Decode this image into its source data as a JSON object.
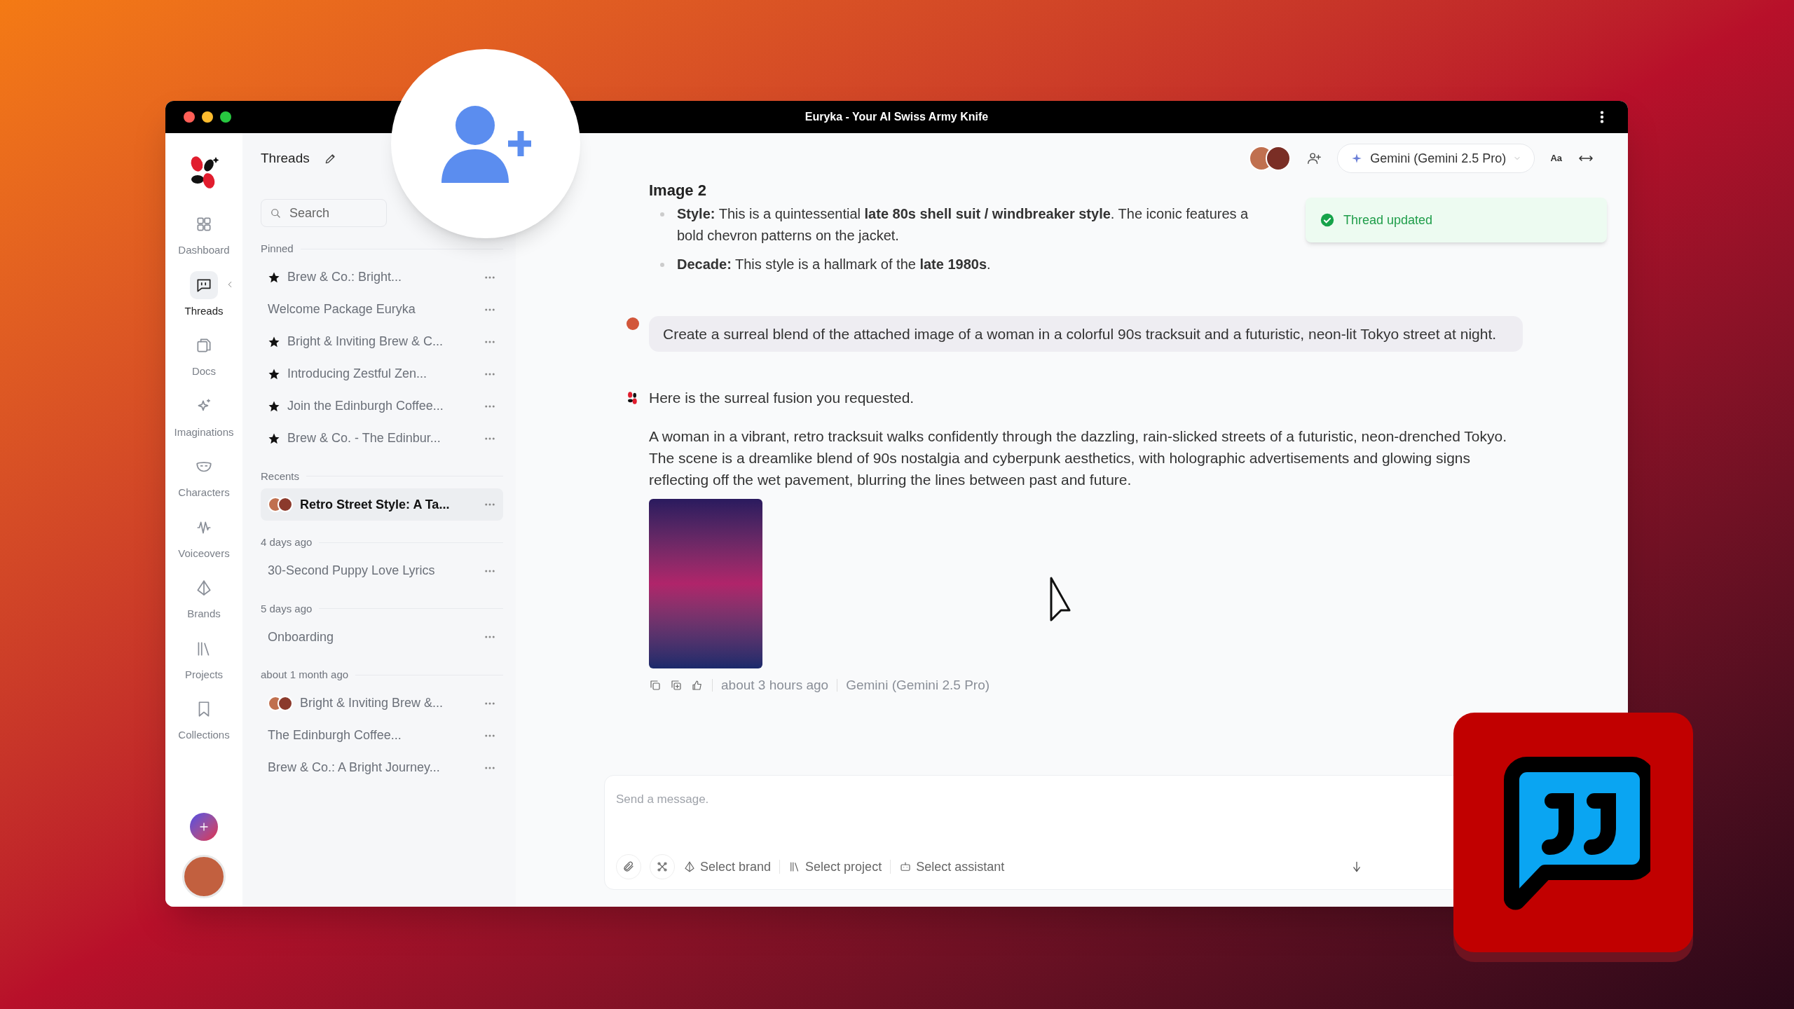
{
  "window": {
    "title": "Euryka - Your AI Swiss Army Knife"
  },
  "nav": [
    {
      "label": "Dashboard",
      "selected": false
    },
    {
      "label": "Threads",
      "selected": true
    },
    {
      "label": "Docs",
      "selected": false
    },
    {
      "label": "Imaginations",
      "selected": false
    },
    {
      "label": "Characters",
      "selected": false
    },
    {
      "label": "Voiceovers",
      "selected": false
    },
    {
      "label": "Brands",
      "selected": false
    },
    {
      "label": "Projects",
      "selected": false
    },
    {
      "label": "Collections",
      "selected": false
    }
  ],
  "threads_panel": {
    "title": "Threads",
    "search": {
      "placeholder": "Search"
    },
    "groups": [
      {
        "label": "Pinned",
        "items": [
          {
            "title": "Brew & Co.: Bright...",
            "starred": true,
            "shared": false,
            "selected": false
          },
          {
            "title": "Welcome Package Euryka",
            "starred": false,
            "shared": false,
            "selected": false
          },
          {
            "title": "Bright & Inviting Brew & C...",
            "starred": true,
            "shared": false,
            "selected": false
          },
          {
            "title": "Introducing Zestful Zen...",
            "starred": true,
            "shared": false,
            "selected": false
          },
          {
            "title": "Join the Edinburgh Coffee...",
            "starred": true,
            "shared": false,
            "selected": false
          },
          {
            "title": "Brew & Co. - The Edinbur...",
            "starred": true,
            "shared": false,
            "selected": false
          }
        ]
      },
      {
        "label": "Recents",
        "items": [
          {
            "title": "Retro Street Style: A Ta...",
            "starred": false,
            "shared": true,
            "selected": true
          }
        ]
      },
      {
        "label": "4 days ago",
        "items": [
          {
            "title": "30-Second Puppy Love Lyrics",
            "starred": false,
            "shared": false,
            "selected": false
          }
        ]
      },
      {
        "label": "5 days ago",
        "items": [
          {
            "title": "Onboarding",
            "starred": false,
            "shared": false,
            "selected": false
          }
        ]
      },
      {
        "label": "about 1 month ago",
        "items": [
          {
            "title": "Bright & Inviting Brew &...",
            "starred": false,
            "shared": true,
            "selected": false
          },
          {
            "title": "The Edinburgh Coffee...",
            "starred": false,
            "shared": false,
            "selected": false
          },
          {
            "title": "Brew & Co.: A Bright Journey...",
            "starred": false,
            "shared": false,
            "selected": false
          }
        ]
      }
    ]
  },
  "top_bar": {
    "model": "Gemini (Gemini 2.5 Pro)",
    "font_button": "Aa"
  },
  "toast": {
    "text": "Thread updated"
  },
  "messages": [
    {
      "kind": "assistant_tail",
      "heading": "Image 2",
      "bullets": [
        {
          "lines": [
            "**Style:** This is a quintessential **late 80s shell suit / windbreaker style**. The iconic features a",
            "bold chevron patterns on the jacket."
          ]
        },
        {
          "lines": [
            "**Decade:** This style is a hallmark of the **late 1980s**."
          ]
        }
      ]
    },
    {
      "kind": "user",
      "text": "Create a surreal blend of the attached image of a woman in a colorful 90s tracksuit and a futuristic, neon-lit Tokyo street at night."
    },
    {
      "kind": "assistant",
      "paragraphs": [
        "Here is the surreal fusion you requested.",
        "A woman in a vibrant, retro tracksuit walks confidently through the dazzling, rain-slicked streets of a futuristic, neon-drenched Tokyo. The scene is a dreamlike blend of 90s nostalgia and cyberpunk aesthetics, with holographic advertisements and glowing signs reflecting off the wet pavement, blurring the lines between past and future."
      ],
      "attachments": [
        {
          "kind": "image"
        }
      ],
      "meta": {
        "time": "about 3 hours ago",
        "model": "Gemini (Gemini 2.5 Pro)"
      }
    }
  ],
  "composer": {
    "placeholder": "Send a message.",
    "selectors": [
      "Select brand",
      "Select project",
      "Select assistant"
    ]
  }
}
